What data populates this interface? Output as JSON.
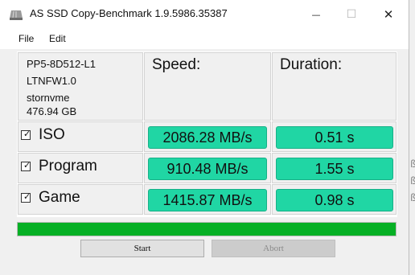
{
  "window": {
    "title": "AS SSD Copy-Benchmark 1.9.5986.35387",
    "icon": "drive-icon",
    "minimize_glyph": "—",
    "maximize_glyph": "☐",
    "close_glyph": "✕"
  },
  "menu": {
    "items": [
      "File",
      "Edit"
    ]
  },
  "drive_info": {
    "model": "PP5-8D512-L1",
    "firmware": "LTNFW1.0",
    "driver": "stornvme",
    "capacity": "476.94 GB"
  },
  "headers": {
    "speed": "Speed:",
    "duration": "Duration:"
  },
  "tests": [
    {
      "name": "ISO",
      "checked": true,
      "checkmark": "✓",
      "speed": "2086.28 MB/s",
      "duration": "0.51 s"
    },
    {
      "name": "Program",
      "checked": true,
      "checkmark": "✓",
      "speed": "910.48 MB/s",
      "duration": "1.55 s"
    },
    {
      "name": "Game",
      "checked": true,
      "checkmark": "✓",
      "speed": "1415.87 MB/s",
      "duration": "0.98 s"
    }
  ],
  "progress": {
    "percent": 100
  },
  "buttons": {
    "start": "Start",
    "abort": "Abort"
  },
  "background_glyphs": [
    "ß",
    "ß",
    "ß"
  ],
  "colors": {
    "result_fill": "#20d6a4",
    "progress_fill": "#06b025"
  }
}
